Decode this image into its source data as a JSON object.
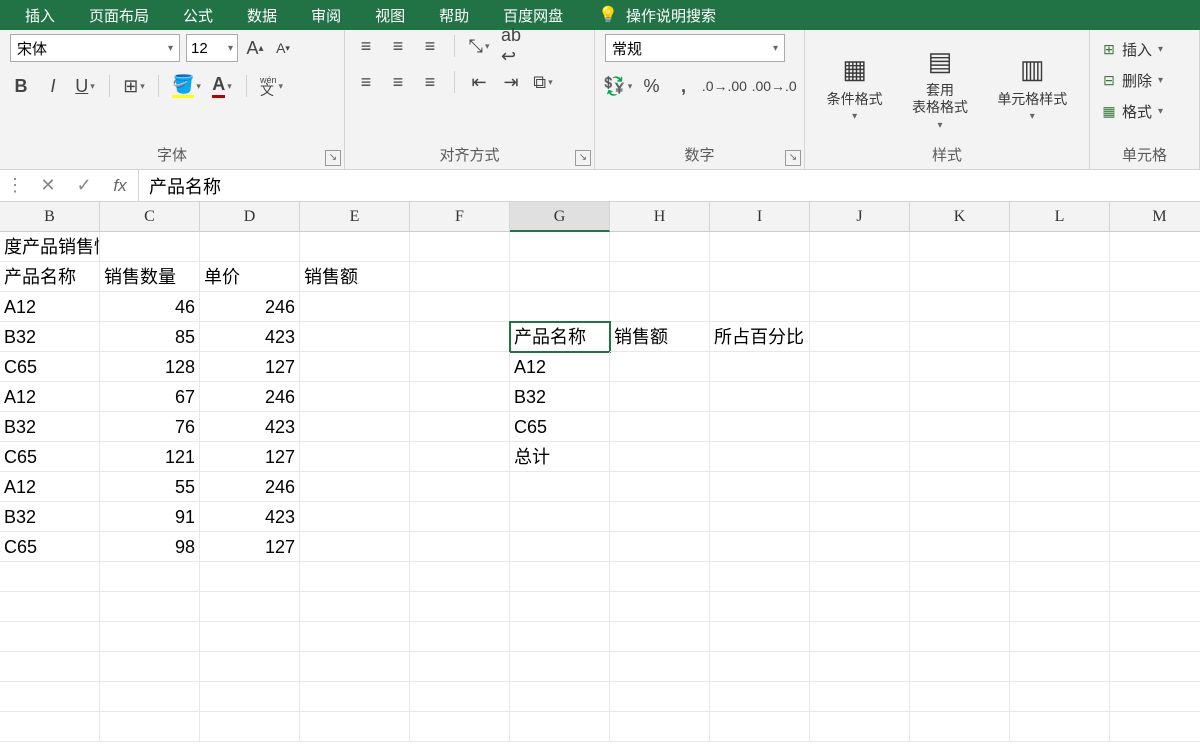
{
  "menu": {
    "items": [
      "插入",
      "页面布局",
      "公式",
      "数据",
      "审阅",
      "视图",
      "帮助",
      "百度网盘"
    ],
    "tell": "操作说明搜索"
  },
  "font": {
    "name": "宋体",
    "size": "12",
    "wen": "wén",
    "labels": {
      "group": "字体"
    }
  },
  "align": {
    "group": "对齐方式"
  },
  "number": {
    "format": "常规",
    "group": "数字"
  },
  "styles": {
    "cond": "条件格式",
    "table": "套用\n表格格式",
    "cell": "单元格样式",
    "group": "样式"
  },
  "cells": {
    "insert": "插入",
    "delete": "删除",
    "format": "格式",
    "group": "单元格"
  },
  "formula_bar": "产品名称",
  "columns": [
    "B",
    "C",
    "D",
    "E",
    "F",
    "G",
    "H",
    "I",
    "J",
    "K",
    "L",
    "M"
  ],
  "sheet": {
    "title": "度产品销售情况表",
    "headers": {
      "b": "产品名称",
      "c": "销售数量",
      "d": "单价",
      "e": "销售额"
    },
    "rows": [
      {
        "b": "A12",
        "c": "46",
        "d": "246"
      },
      {
        "b": "B32",
        "c": "85",
        "d": "423"
      },
      {
        "b": "C65",
        "c": "128",
        "d": "127"
      },
      {
        "b": "A12",
        "c": "67",
        "d": "246"
      },
      {
        "b": "B32",
        "c": "76",
        "d": "423"
      },
      {
        "b": "C65",
        "c": "121",
        "d": "127"
      },
      {
        "b": "A12",
        "c": "55",
        "d": "246"
      },
      {
        "b": "B32",
        "c": "91",
        "d": "423"
      },
      {
        "b": "C65",
        "c": "98",
        "d": "127"
      }
    ],
    "side": {
      "g1": "产品名称",
      "h1": "销售额",
      "i1": "所占百分比",
      "glist": [
        "A12",
        "B32",
        "C65",
        "总计"
      ]
    }
  }
}
